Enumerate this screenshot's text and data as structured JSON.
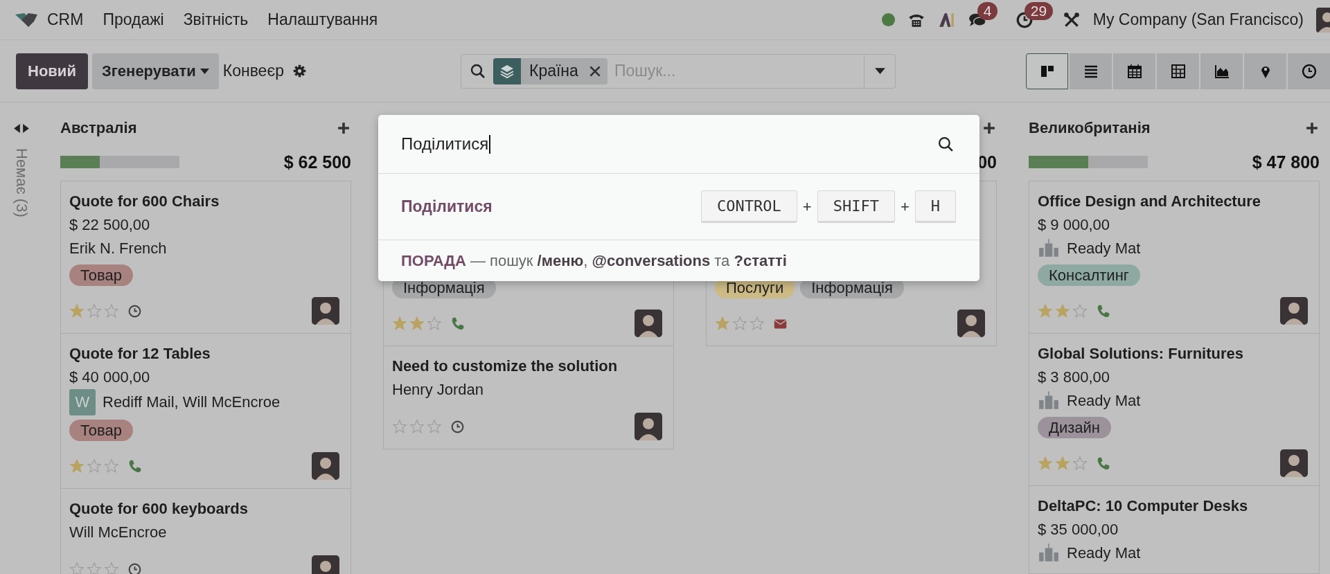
{
  "navbar": {
    "app": "CRM",
    "menu": [
      "Продажі",
      "Звітність",
      "Налаштування"
    ],
    "chat_badge": "4",
    "activity_badge": "29",
    "company": "My Company (San Francisco)"
  },
  "control_panel": {
    "new_button": "Новий",
    "generate_button": "Згенерувати",
    "pipeline": "Конвеєр",
    "search": {
      "facet": "Країна",
      "placeholder": "Пошук..."
    },
    "views": [
      {
        "kind": "kanban",
        "selected": true
      },
      {
        "kind": "list",
        "selected": false
      },
      {
        "kind": "calendar",
        "selected": false
      },
      {
        "kind": "pivot",
        "selected": false
      },
      {
        "kind": "graph",
        "selected": false
      },
      {
        "kind": "map",
        "selected": false
      },
      {
        "kind": "activity",
        "selected": false
      }
    ]
  },
  "folded_column": {
    "label": "Немає (3)"
  },
  "columns": [
    {
      "title": "Австралія",
      "add_button": true,
      "total": "$ 62 500",
      "level": 0.33,
      "cards": [
        {
          "title": "Quote for 600 Chairs",
          "amount": "$ 22 500,00",
          "contact": {
            "kind": "plain",
            "name": "Erik N. French"
          },
          "tags": [
            {
              "label": "Товар",
              "color": "#a8827f"
            }
          ],
          "stars": 1,
          "activity": {
            "kind": "clock"
          }
        },
        {
          "title": "Quote for 12 Tables",
          "amount": "$ 40 000,00",
          "contact": {
            "kind": "initial",
            "initial": "W",
            "name": "Rediff Mail, Will McEncroe"
          },
          "tags": [
            {
              "label": "Товар",
              "color": "#a8827f"
            }
          ],
          "stars": 1,
          "activity": {
            "kind": "phone"
          }
        },
        {
          "title": "Quote for 600 keyboards",
          "contact": {
            "kind": "plain",
            "name": "Will McEncroe"
          },
          "stars": 0,
          "activity": {
            "kind": "clock"
          }
        }
      ]
    },
    {
      "cards": [
        {
          "tags": [
            {
              "label": "Інформація",
              "color": "#a6a7a9"
            }
          ],
          "stars": 2,
          "activity": {
            "kind": "phone"
          }
        },
        {
          "title": "Need to customize the solution",
          "contact": {
            "kind": "plain",
            "name": "Henry Jordan"
          },
          "stars": 0,
          "activity": {
            "kind": "clock"
          }
        }
      ]
    },
    {
      "add_button": true,
      "total": "00",
      "cards": [
        {
          "tags": [
            {
              "label": "Послуги",
              "color": "#cdbb86"
            },
            {
              "label": "Інформація",
              "color": "#a6a7a9"
            }
          ],
          "stars": 1,
          "activity": {
            "kind": "envelope"
          }
        }
      ]
    },
    {
      "title": "Великобританія",
      "add_button": true,
      "total": "$ 47 800",
      "level": 0.5,
      "cards": [
        {
          "title": "Office Design and Architecture",
          "amount": "$ 9 000,00",
          "contact": {
            "kind": "logo",
            "name": "Ready Mat"
          },
          "tags": [
            {
              "label": "Консалтинг",
              "color": "#8ea8a2"
            }
          ],
          "stars": 2,
          "activity": {
            "kind": "phone"
          }
        },
        {
          "title": "Global Solutions: Furnitures",
          "amount": "$ 3 800,00",
          "contact": {
            "kind": "logo",
            "name": "Ready Mat"
          },
          "tags": [
            {
              "label": "Дизайн",
              "color": "#9c929b"
            }
          ],
          "stars": 2,
          "activity": {
            "kind": "phone"
          }
        },
        {
          "title": "DeltaPC: 10 Computer Desks",
          "amount": "$ 35 000,00",
          "contact": {
            "kind": "logo",
            "name": "Ready Mat"
          }
        }
      ]
    }
  ],
  "palette": {
    "query": "Поділитися",
    "result": {
      "label": "Поділитися",
      "shortcut": [
        {
          "kind": "key",
          "text": "CONTROL"
        },
        {
          "kind": "separator",
          "text": "+"
        },
        {
          "kind": "key",
          "text": "SHIFT"
        },
        {
          "kind": "separator",
          "text": "+"
        },
        {
          "kind": "key",
          "text": "H"
        }
      ]
    },
    "hint": {
      "label": "ПОРАДА",
      "text": "— пошук **/меню**, **@conversations** та **?статті**"
    }
  }
}
